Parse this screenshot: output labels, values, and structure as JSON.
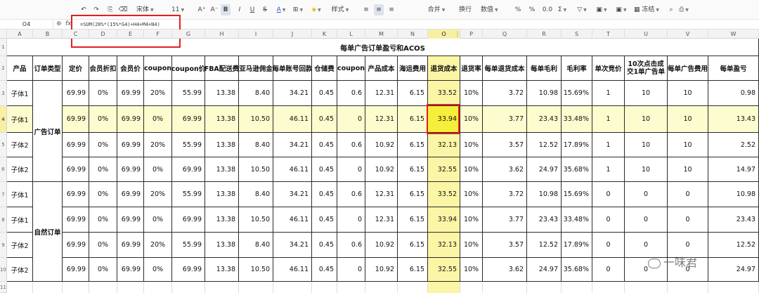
{
  "toolbar": {
    "undo": "↶",
    "redo": "↷",
    "paste": "⎘",
    "eraser": "⌫",
    "font_name": "宋体",
    "font_size": "11",
    "grow": "A⁺",
    "shrink": "A⁻",
    "bold": "B",
    "italic": "I",
    "underline": "U",
    "strike": "S",
    "font_color": "A",
    "border": "⊞",
    "fill": "◈",
    "style": "样式",
    "align_left": "≡",
    "align_center": "≡",
    "align_right": "≡",
    "merge": "合并",
    "wrap": "换行",
    "number_format": "数值",
    "percent": "%",
    "currency": "%",
    "decimals": "0.0",
    "sum": "Σ",
    "filter": "▽",
    "image": "▣",
    "freeze": "冻结",
    "print": "⎙"
  },
  "formula_bar": {
    "cell_ref": "O4",
    "zoom_icon": "⊕",
    "fx": "fx",
    "formula": "=SUM(20%*(15%*G4)+H4+M4+N4)"
  },
  "columns": [
    "A",
    "B",
    "C",
    "D",
    "E",
    "F",
    "G",
    "H",
    "I",
    "J",
    "K",
    "L",
    "M",
    "N",
    "O",
    "P",
    "Q",
    "R",
    "S",
    "T",
    "U",
    "V",
    "W"
  ],
  "row_numbers": [
    "1",
    "2",
    "3",
    "4",
    "5",
    "6",
    "7",
    "8",
    "9",
    "10",
    "11"
  ],
  "sheet": {
    "title": "每单广告订单盈亏和ACOS",
    "headers": [
      "产品",
      "订单类型",
      "定价",
      "会员折扣",
      "会员价",
      "coupon",
      "coupon价",
      "FBA配送费",
      "亚马逊佣金",
      "每单账号回款",
      "仓储费",
      "coupon",
      "产品成本",
      "海运费用",
      "退货成本",
      "退货率",
      "每单退货成本",
      "每单毛利",
      "毛利率",
      "单次竞价",
      "10次点击成交1单广告单",
      "每单广告费用",
      "每单盈亏"
    ],
    "group_ad": "广告订单",
    "group_organic": "自然订单",
    "rows": [
      [
        "子体1",
        "69.99",
        "0%",
        "69.99",
        "20%",
        "55.99",
        "13.38",
        "8.40",
        "34.21",
        "0.45",
        "0.6",
        "12.31",
        "6.15",
        "33.52",
        "10%",
        "3.72",
        "10.98",
        "15.69%",
        "1",
        "10",
        "10",
        "0.98"
      ],
      [
        "子体1",
        "69.99",
        "0%",
        "69.99",
        "0%",
        "69.99",
        "13.38",
        "10.50",
        "46.11",
        "0.45",
        "0",
        "12.31",
        "6.15",
        "33.94",
        "10%",
        "3.77",
        "23.43",
        "33.48%",
        "1",
        "10",
        "10",
        "13.43"
      ],
      [
        "子体2",
        "69.99",
        "0%",
        "69.99",
        "20%",
        "55.99",
        "13.38",
        "8.40",
        "34.21",
        "0.45",
        "0.6",
        "10.92",
        "6.15",
        "32.13",
        "10%",
        "3.57",
        "12.52",
        "17.89%",
        "1",
        "10",
        "10",
        "2.52"
      ],
      [
        "子体2",
        "69.99",
        "0%",
        "69.99",
        "0%",
        "69.99",
        "13.38",
        "10.50",
        "46.11",
        "0.45",
        "0",
        "10.92",
        "6.15",
        "32.55",
        "10%",
        "3.62",
        "24.97",
        "35.68%",
        "1",
        "10",
        "10",
        "14.97"
      ],
      [
        "子体1",
        "69.99",
        "0%",
        "69.99",
        "20%",
        "55.99",
        "13.38",
        "8.40",
        "34.21",
        "0.45",
        "0.6",
        "12.31",
        "6.15",
        "33.52",
        "10%",
        "3.72",
        "10.98",
        "15.69%",
        "0",
        "0",
        "0",
        "10.98"
      ],
      [
        "子体1",
        "69.99",
        "0%",
        "69.99",
        "0%",
        "69.99",
        "13.38",
        "10.50",
        "46.11",
        "0.45",
        "0",
        "12.31",
        "6.15",
        "33.94",
        "10%",
        "3.77",
        "23.43",
        "33.48%",
        "0",
        "0",
        "0",
        "23.43"
      ],
      [
        "子体2",
        "69.99",
        "0%",
        "69.99",
        "20%",
        "55.99",
        "13.38",
        "8.40",
        "34.21",
        "0.45",
        "0.6",
        "10.92",
        "6.15",
        "32.13",
        "10%",
        "3.57",
        "12.52",
        "17.89%",
        "0",
        "0",
        "0",
        "12.52"
      ],
      [
        "子体2",
        "69.99",
        "0%",
        "69.99",
        "0%",
        "69.99",
        "13.38",
        "10.50",
        "46.11",
        "0.45",
        "0",
        "10.92",
        "6.15",
        "32.55",
        "10%",
        "3.62",
        "24.97",
        "35.68%",
        "0",
        "0",
        "0",
        "24.97"
      ]
    ]
  },
  "watermark": "一味君",
  "colors": {
    "highlight_col": "#fbf6a5",
    "highlight_row": "#fdfccf",
    "selected_cell": "#f5ee3a",
    "annotation_red": "#e02020"
  }
}
